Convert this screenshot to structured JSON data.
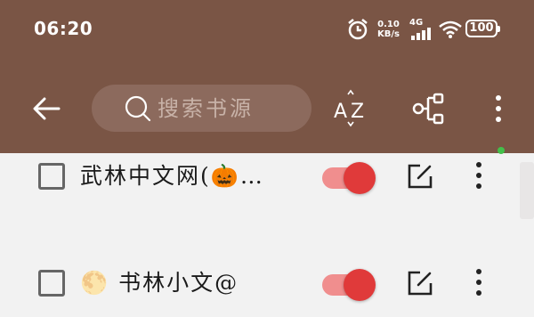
{
  "status_bar": {
    "time": "06:20",
    "net_speed_value": "0.10",
    "net_speed_unit": "KB/s",
    "network_type": "4G",
    "battery": "100"
  },
  "toolbar": {
    "search_placeholder": "搜索书源"
  },
  "sources": [
    {
      "name": "武林中文网(🎃…",
      "enabled": true
    },
    {
      "name": "🌕 书林小文@",
      "enabled": true
    }
  ],
  "colors": {
    "appbar": "#7a5545",
    "accent_red": "#e03a3a",
    "track_red": "#f08e8e"
  }
}
